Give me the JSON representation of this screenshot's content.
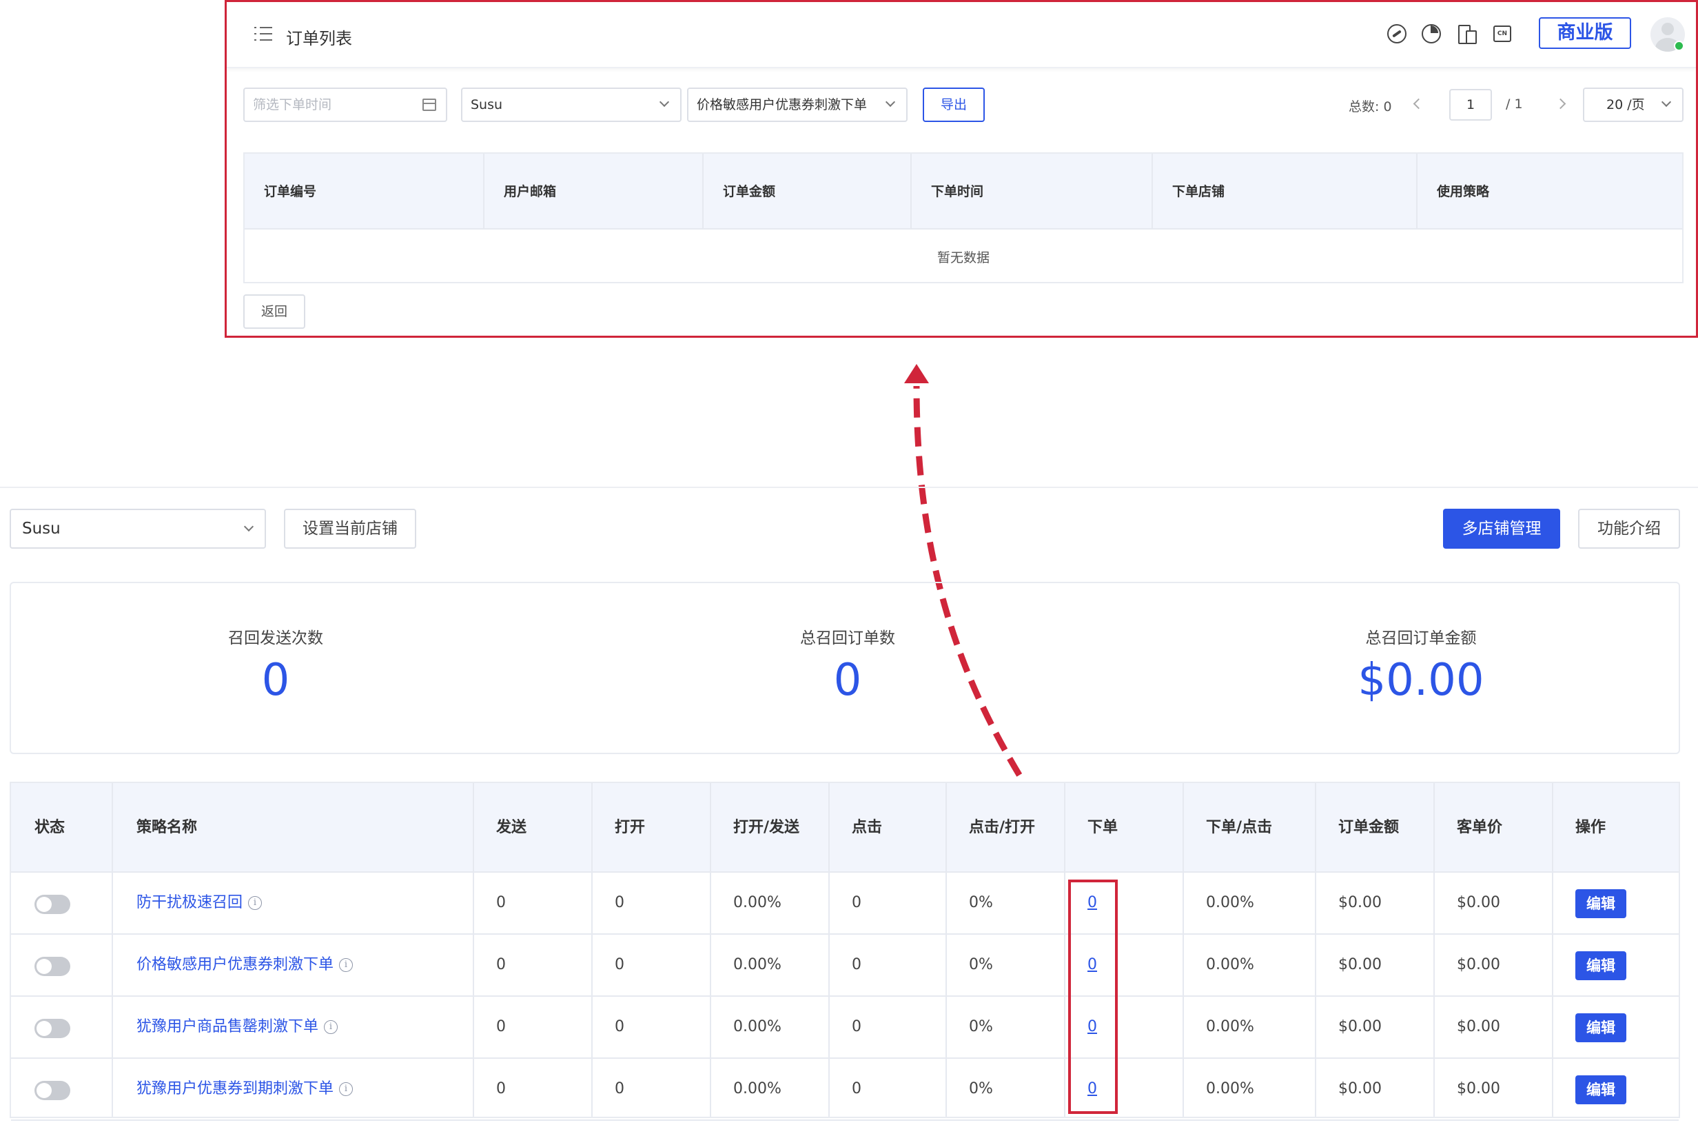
{
  "order_list": {
    "title": "订单列表",
    "business_badge": "商业版",
    "header_icons": [
      "compass-icon",
      "pie-chart-icon",
      "device-icon",
      "cn-language-icon"
    ],
    "language_badge": "CN",
    "date_filter_placeholder": "筛选下单时间",
    "store_filter": "Susu",
    "strategy_filter": "价格敏感用户优惠券刺激下单",
    "export_label": "导出",
    "total_label": "总数: 0",
    "current_page": "1",
    "page_total": "/ 1",
    "page_size": "20 /页",
    "columns": [
      "订单编号",
      "用户邮箱",
      "订单金额",
      "下单时间",
      "下单店铺",
      "使用策略"
    ],
    "empty_text": "暂无数据",
    "back_label": "返回"
  },
  "dashboard": {
    "store_select": "Susu",
    "set_store_label": "设置当前店铺",
    "multi_store_label": "多店铺管理",
    "features_label": "功能介绍",
    "stats": [
      {
        "label": "召回发送次数",
        "value": "0"
      },
      {
        "label": "总召回订单数",
        "value": "0"
      },
      {
        "label": "总召回订单金额",
        "value": "$0.00"
      }
    ],
    "columns": [
      "状态",
      "策略名称",
      "发送",
      "打开",
      "打开/发送",
      "点击",
      "点击/打开",
      "下单",
      "下单/点击",
      "订单金额",
      "客单价",
      "操作"
    ],
    "rows": [
      {
        "name": "防干扰极速召回",
        "send": "0",
        "open": "0",
        "open_rate": "0.00%",
        "click": "0",
        "click_rate": "0%",
        "orders": "0",
        "order_rate": "0.00%",
        "amount": "$0.00",
        "avg_price": "$0.00",
        "action": "编辑",
        "enabled": false
      },
      {
        "name": "价格敏感用户优惠券刺激下单",
        "send": "0",
        "open": "0",
        "open_rate": "0.00%",
        "click": "0",
        "click_rate": "0%",
        "orders": "0",
        "order_rate": "0.00%",
        "amount": "$0.00",
        "avg_price": "$0.00",
        "action": "编辑",
        "enabled": false
      },
      {
        "name": "犹豫用户商品售罄刺激下单",
        "send": "0",
        "open": "0",
        "open_rate": "0.00%",
        "click": "0",
        "click_rate": "0%",
        "orders": "0",
        "order_rate": "0.00%",
        "amount": "$0.00",
        "avg_price": "$0.00",
        "action": "编辑",
        "enabled": false
      },
      {
        "name": "犹豫用户优惠券到期刺激下单",
        "send": "0",
        "open": "0",
        "open_rate": "0.00%",
        "click": "0",
        "click_rate": "0%",
        "orders": "0",
        "order_rate": "0.00%",
        "amount": "$0.00",
        "avg_price": "$0.00",
        "action": "编辑",
        "enabled": false
      }
    ]
  },
  "annotation": {
    "highlight_color": "#d0253a",
    "arrow_color": "#d0253a"
  },
  "colors": {
    "accent": "#2c55e6",
    "online_dot": "#2dbb4f"
  }
}
